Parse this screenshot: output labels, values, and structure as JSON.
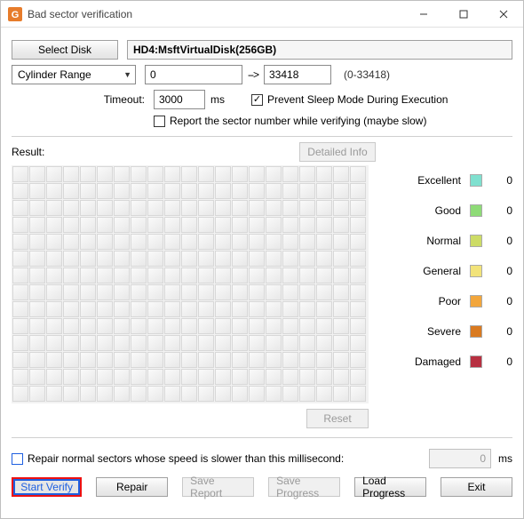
{
  "window": {
    "title": "Bad sector verification"
  },
  "selectDisk": {
    "label": "Select Disk",
    "value": "HD4:MsftVirtualDisk(256GB)"
  },
  "range": {
    "dropdown": "Cylinder Range",
    "from": "0",
    "to": "33418",
    "hint": "(0-33418)"
  },
  "timeout": {
    "label": "Timeout:",
    "value": "3000",
    "unit": "ms"
  },
  "options": {
    "preventSleep": {
      "label": "Prevent Sleep Mode During Execution",
      "checked": true
    },
    "reportSector": {
      "label": "Report the sector number while verifying (maybe slow)",
      "checked": false
    }
  },
  "result": {
    "label": "Result:",
    "detailedInfo": "Detailed Info",
    "reset": "Reset"
  },
  "legend": [
    {
      "name": "Excellent",
      "color": "#7fe0cf",
      "count": 0
    },
    {
      "name": "Good",
      "color": "#8edb77",
      "count": 0
    },
    {
      "name": "Normal",
      "color": "#cddc66",
      "count": 0
    },
    {
      "name": "General",
      "color": "#f2e37a",
      "count": 0
    },
    {
      "name": "Poor",
      "color": "#f2a63c",
      "count": 0
    },
    {
      "name": "Severe",
      "color": "#d97a20",
      "count": 0
    },
    {
      "name": "Damaged",
      "color": "#b73041",
      "count": 0
    }
  ],
  "repairOption": {
    "label": "Repair normal sectors whose speed is slower than this millisecond:",
    "value": "0",
    "unit": "ms",
    "checked": false
  },
  "buttons": {
    "startVerify": "Start Verify",
    "repair": "Repair",
    "saveReport": "Save Report",
    "saveProgress": "Save Progress",
    "loadProgress": "Load Progress",
    "exit": "Exit"
  }
}
